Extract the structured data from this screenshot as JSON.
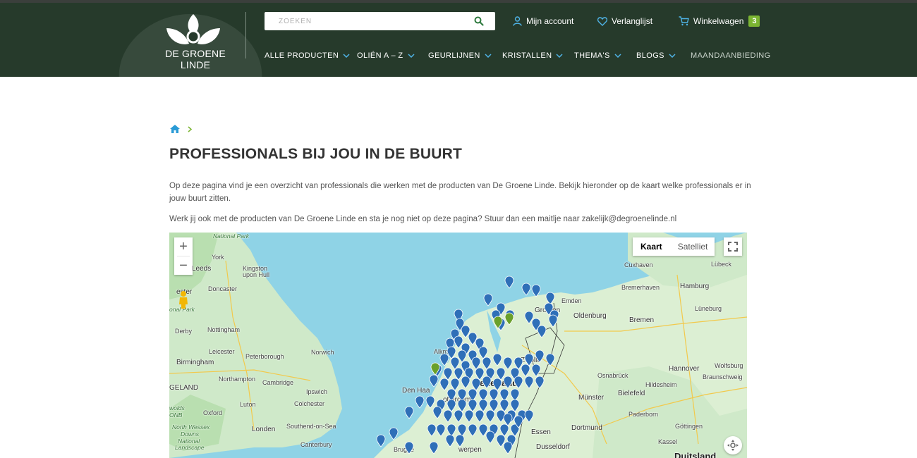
{
  "header": {
    "logo_text": "DE GROENE LINDE",
    "search_placeholder": "ZOEKEN",
    "account_label": "Mijn account",
    "wishlist_label": "Verlanglijst",
    "cart_label": "Winkelwagen",
    "cart_count": "3",
    "nav": [
      {
        "label": "ALLE PRODUCTEN"
      },
      {
        "label": "OLIËN A – Z"
      },
      {
        "label": "GEURLIJNEN"
      },
      {
        "label": "KRISTALLEN"
      },
      {
        "label": "THEMA'S"
      },
      {
        "label": "BLOGS"
      },
      {
        "label": "MAANDAANBIEDING"
      }
    ]
  },
  "colors": {
    "header_bg": "#263a2b",
    "accent_green": "#7bb532",
    "link_blue": "#2a9bd6",
    "pin_blue": "#2f6fb8",
    "pin_green": "#6aa02a"
  },
  "page": {
    "title": "PROFESSIONALS BIJ JOU IN DE BUURT",
    "intro": "Op deze pagina vind je een overzicht van professionals die werken met de producten van De Groene Linde. Bekijk hieronder op de kaart welke professionals er in jouw buurt zitten.",
    "contact": "Werk jij ook met de producten van De Groene Linde en sta je nog niet op deze pagina? Stuur dan een maitlje naar zakelijk@degroenelinde.nl"
  },
  "map": {
    "type_buttons": [
      "Kaart",
      "Satelliet"
    ],
    "active_type": "Kaart",
    "zoom_in": "+",
    "zoom_out": "−",
    "labels": {
      "national_park": "National Park",
      "york": "York",
      "leeds": "Leeds",
      "kingston": "Kingston",
      "upon_hull": "upon Hull",
      "doncaster": "Doncaster",
      "ester": "ester",
      "onal_park": "onal Park",
      "derby": "Derby",
      "nottingham": "Nottingham",
      "leicester": "Leicester",
      "peterborough": "Peterborough",
      "norwich": "Norwich",
      "birmingham": "Birmingham",
      "northampton": "Northampton",
      "cambridge": "Cambridge",
      "ipswich": "Ipswich",
      "gland": "GELAND",
      "colchester": "Colchester",
      "wolds": "wolds",
      "onb": "ONB",
      "oxford": "Oxford",
      "luton": "Luton",
      "north_wessex": "North Wessex",
      "downs": "Downs",
      "national": "National",
      "landscape": "Landscape",
      "londen": "Londen",
      "southend": "Southend-on-Sea",
      "canterbury": "Canterbury",
      "brugge": "Brugge",
      "antwerpen": "werpen",
      "den_haag": "Den Haa",
      "rotterdam": "otterdam",
      "nederland": "ederland",
      "alkm": "Alkm",
      "zwolle": "Zwolle",
      "groningen": "Gro     gen",
      "emden": "Emden",
      "oldenburg": "Oldenburg",
      "bremerhaven": "Bremerhaven",
      "bremen": "Bremen",
      "hamburg": "Hamburg",
      "cuxhaven": "Cuxhaven",
      "lubeck": "Lübeck",
      "luneburg": "Lüneburg",
      "hannover": "Hannover",
      "wolfsburg": "Wolfsburg",
      "braunschweig": "Braunschweig",
      "osnabruck": "Osnabrück",
      "bielefeld": "Bielefeld",
      "hildesheim": "Hildesheim",
      "munster": "Münster",
      "paderborn": "Paderborn",
      "gottingen": "Göttingen",
      "essen": "Essen",
      "dortmund": "Dortmund",
      "dusseldorf": "Dusseldorf",
      "kassel": "Kassel",
      "duitsland": "Duitsland"
    }
  }
}
